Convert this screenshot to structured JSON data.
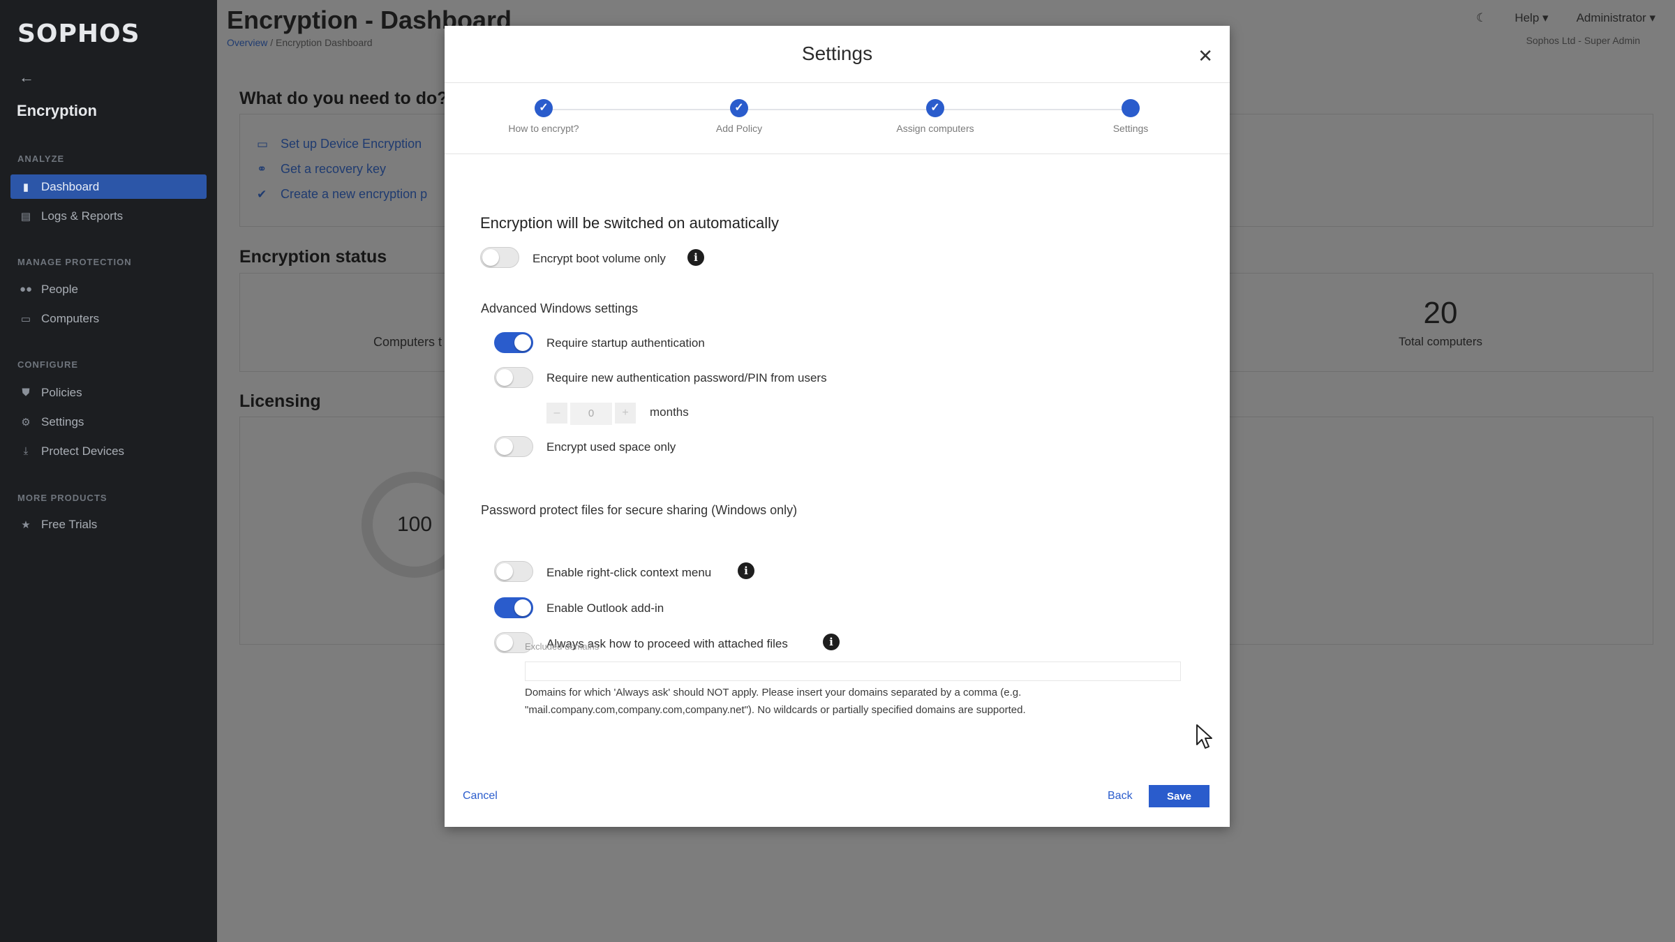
{
  "sidebar": {
    "logo": "SOPHOS",
    "back_icon": "arrow-left-icon",
    "section_title": "Encryption",
    "groups": [
      {
        "label": "ANALYZE",
        "items": [
          {
            "label": "Dashboard",
            "icon": "bar-chart-icon",
            "active": true
          },
          {
            "label": "Logs & Reports",
            "icon": "clipboard-icon",
            "active": false
          }
        ]
      },
      {
        "label": "MANAGE PROTECTION",
        "items": [
          {
            "label": "People",
            "icon": "people-icon",
            "active": false
          },
          {
            "label": "Computers",
            "icon": "monitor-icon",
            "active": false
          }
        ]
      },
      {
        "label": "CONFIGURE",
        "items": [
          {
            "label": "Policies",
            "icon": "shield-icon",
            "active": false
          },
          {
            "label": "Settings",
            "icon": "gear-icon",
            "active": false
          },
          {
            "label": "Protect Devices",
            "icon": "download-icon",
            "active": false
          }
        ]
      },
      {
        "label": "MORE PRODUCTS",
        "items": [
          {
            "label": "Free Trials",
            "icon": "star-icon",
            "active": false
          }
        ]
      }
    ]
  },
  "header": {
    "title": "Encryption - Dashboard",
    "breadcrumb": [
      "Overview",
      "Encryption Dashboard"
    ],
    "breadcrumb_sep": "/",
    "theme_icon": "moon-icon",
    "help_label": "Help",
    "admin_label": "Administrator",
    "org_label": "Sophos Ltd - Super Admin"
  },
  "main": {
    "todo_title": "What do you need to do?",
    "todo_links": [
      {
        "label": "Set up Device Encryption",
        "icon": "monitor-icon"
      },
      {
        "label": "Get a recovery key",
        "icon": "key-icon"
      },
      {
        "label": "Create a new encryption p",
        "icon": "shield-check-icon"
      }
    ],
    "status_title": "Encryption status",
    "status_partial_label": "Computers t",
    "total_value": "20",
    "total_label": "Total computers",
    "licensing_title": "Licensing",
    "license_value": "100"
  },
  "modal": {
    "title": "Settings",
    "close_icon": "close-icon",
    "steps": [
      {
        "label": "How to encrypt?",
        "done": true
      },
      {
        "label": "Add Policy",
        "done": true
      },
      {
        "label": "Assign computers",
        "done": true
      },
      {
        "label": "Settings",
        "done": false
      }
    ],
    "auto_heading": "Encryption will be switched on automatically",
    "boot_volume": {
      "label": "Encrypt boot volume only",
      "on": false
    },
    "windows_heading": "Advanced Windows settings",
    "startup_auth": {
      "label": "Require startup authentication",
      "on": true
    },
    "new_pin": {
      "label": "Require new authentication password/PIN from users",
      "on": false
    },
    "months_value": "0",
    "months_label": "months",
    "minus_glyph": "–",
    "plus_glyph": "+",
    "used_space": {
      "label": "Encrypt used space only",
      "on": false
    },
    "password_heading": "Password protect files for secure sharing (Windows only)",
    "context_menu": {
      "label": "Enable right-click context menu",
      "on": false
    },
    "outlook_addin": {
      "label": "Enable Outlook add-in",
      "on": true
    },
    "always_ask": {
      "label": "Always ask how to proceed with attached files",
      "on": false
    },
    "excluded_label": "Excluded domains",
    "excluded_value": "",
    "excluded_help": "Domains for which 'Always ask' should NOT apply. Please insert your domains separated by a comma (e.g. \"mail.company.com,company.com,company.net\"). No wildcards or partially specified domains are supported.",
    "cancel_label": "Cancel",
    "back_label": "Back",
    "save_label": "Save",
    "info_glyph": "i"
  },
  "colors": {
    "accent": "#2a5ccc",
    "sidebar_bg": "#1c1e21",
    "overlay_bg": "#7d7d7d"
  }
}
